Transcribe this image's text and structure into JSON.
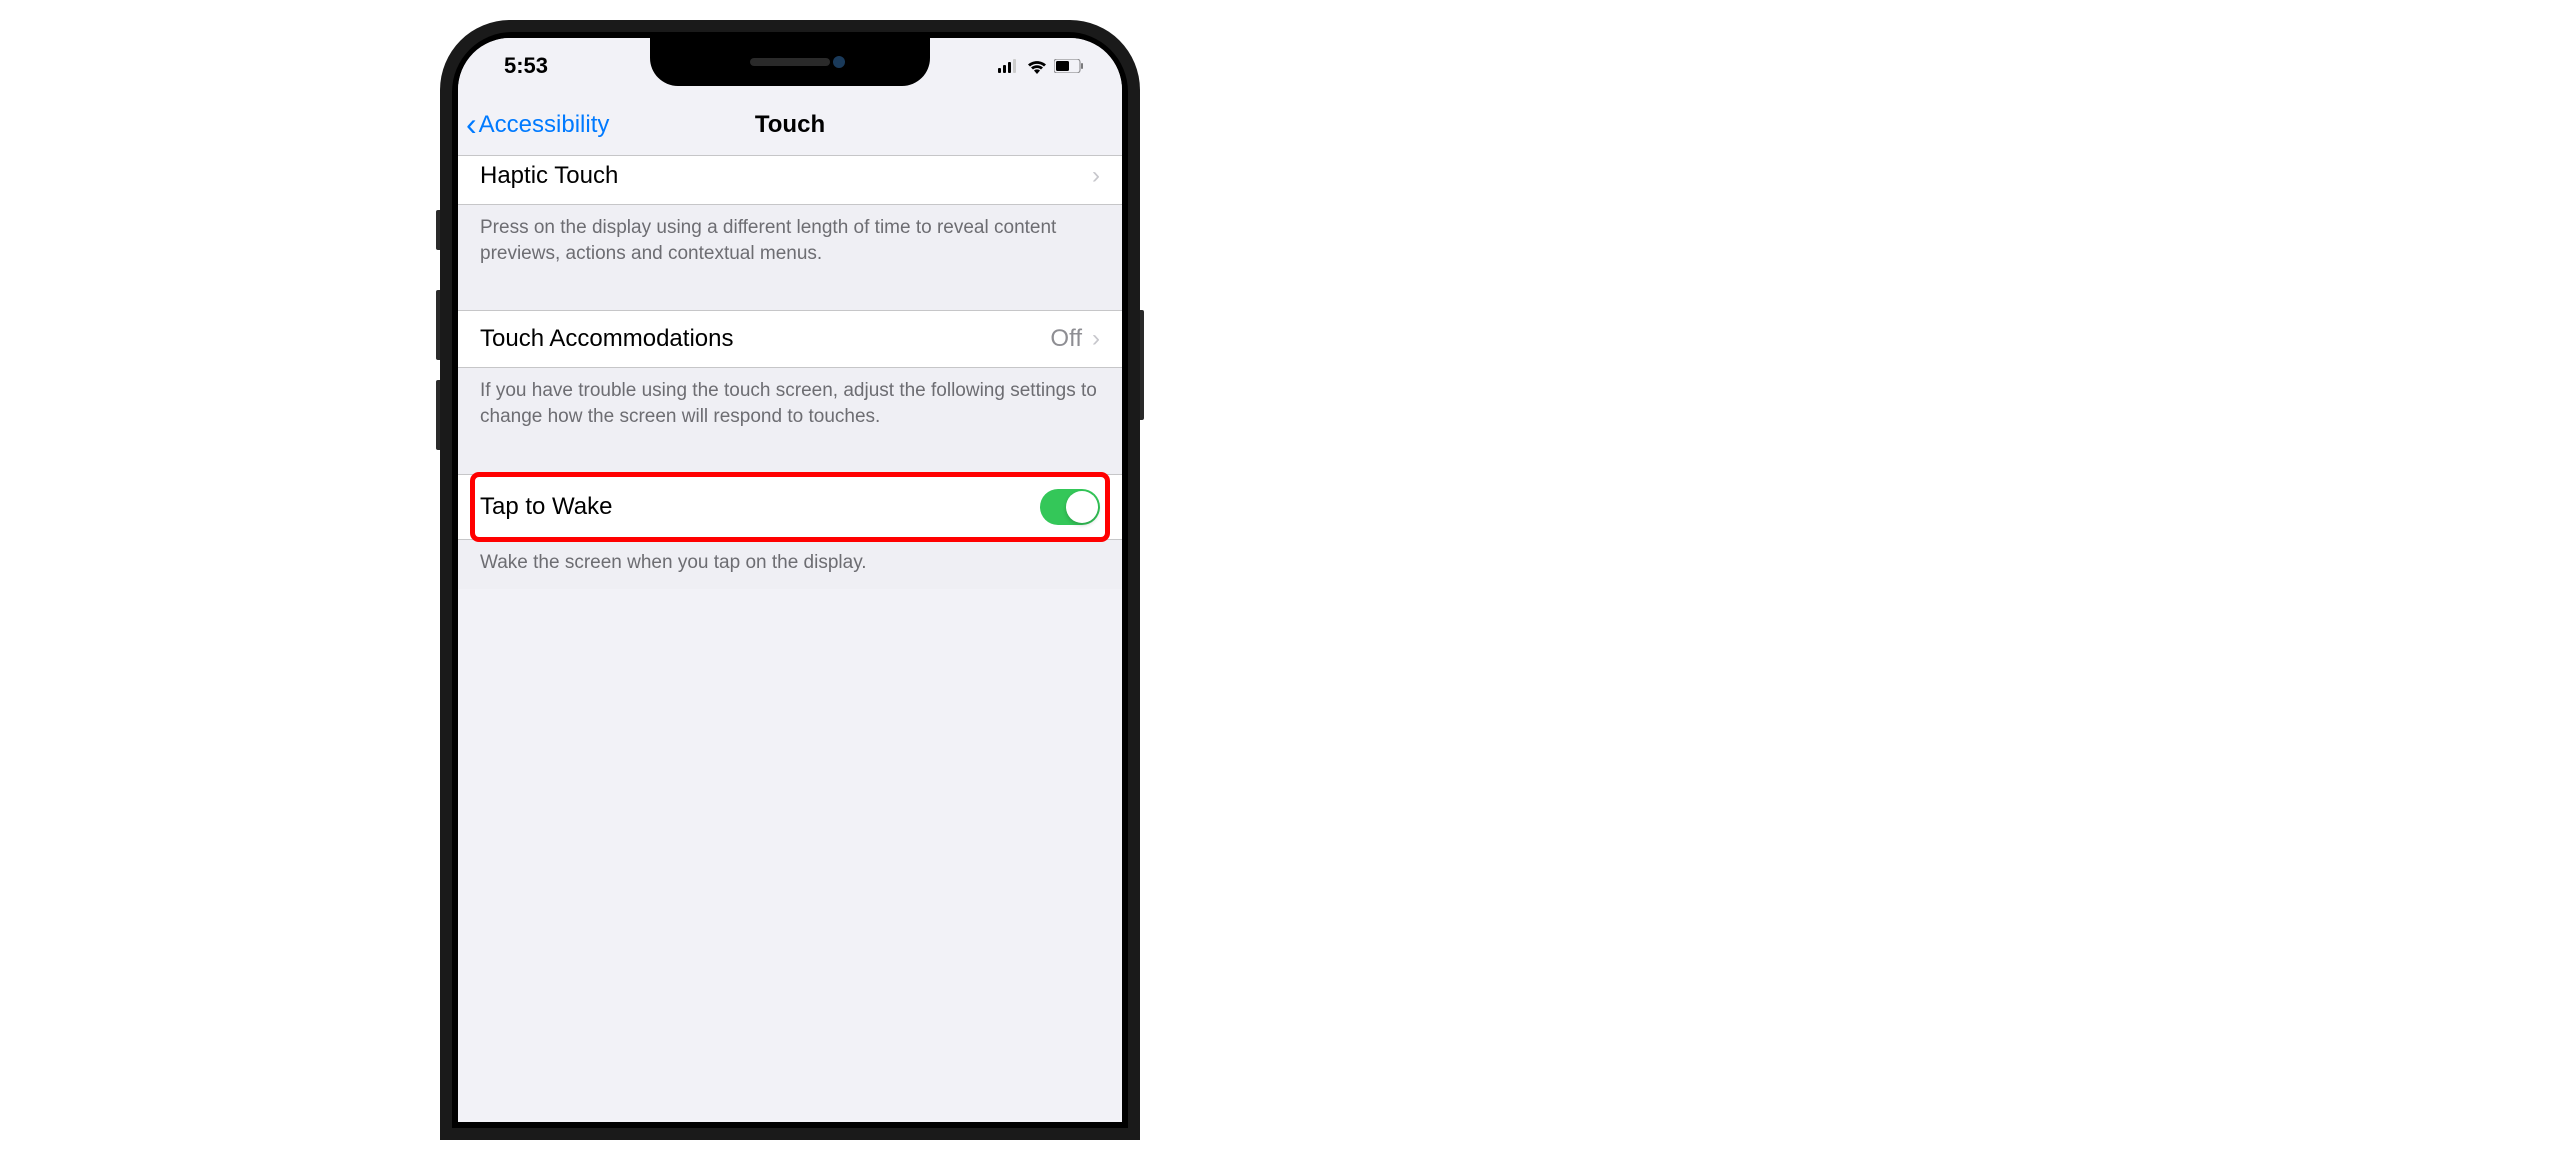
{
  "status": {
    "time": "5:53"
  },
  "nav": {
    "back_label": "Accessibility",
    "title": "Touch"
  },
  "rows": {
    "haptic_touch": {
      "label": "Haptic Touch",
      "footer": "Press on the display using a different length of time to reveal content previews, actions and contextual menus."
    },
    "touch_accommodations": {
      "label": "Touch Accommodations",
      "value": "Off",
      "footer": "If you have trouble using the touch screen, adjust the following settings to change how the screen will respond to touches."
    },
    "tap_to_wake": {
      "label": "Tap to Wake",
      "enabled": true,
      "footer": "Wake the screen when you tap on the display."
    }
  }
}
